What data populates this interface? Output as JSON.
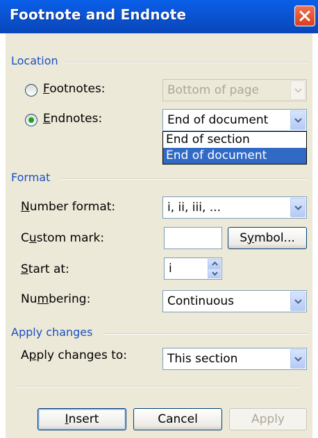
{
  "window": {
    "title": "Footnote and Endnote"
  },
  "location": {
    "section_label": "Location",
    "footnotes": {
      "label_u": "F",
      "label_rest": "ootnotes:",
      "selected": false,
      "value": "Bottom of page"
    },
    "endnotes": {
      "label_u": "E",
      "label_rest": "ndnotes:",
      "selected": true,
      "value": "End of document"
    },
    "endnotes_options": [
      "End of section",
      "End of document"
    ]
  },
  "format": {
    "section_label": "Format",
    "number_format": {
      "label_u": "N",
      "label_rest": "umber format:",
      "value": "i, ii, iii, ..."
    },
    "custom_mark": {
      "label_pre": "C",
      "label_u": "u",
      "label_rest": "stom mark:",
      "value": "",
      "symbol_pre": "S",
      "symbol_u": "y",
      "symbol_rest": "mbol..."
    },
    "start_at": {
      "label_u": "S",
      "label_rest": "tart at:",
      "value": "i"
    },
    "numbering": {
      "label_pre": "Nu",
      "label_u": "m",
      "label_rest": "bering:",
      "value": "Continuous"
    }
  },
  "apply": {
    "section_label": "Apply changes",
    "label_pre": "A",
    "label_u": "p",
    "label_rest": "ply changes to:",
    "value": "This section"
  },
  "buttons": {
    "insert_u": "I",
    "insert_rest": "nsert",
    "cancel": "Cancel",
    "apply": "Apply"
  },
  "colors": {
    "title_bar": "#0b55d6",
    "section_label": "#1a4fc4",
    "selection": "#316ac5",
    "radio_dot": "#21a121"
  }
}
